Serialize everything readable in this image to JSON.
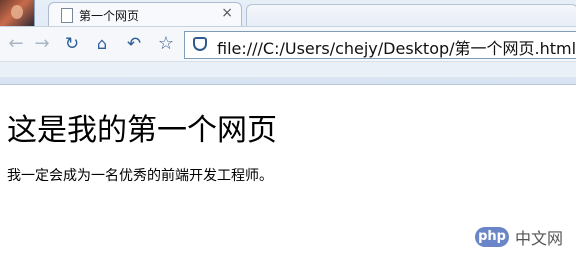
{
  "browser": {
    "tab_title": "第一个网页",
    "tab_close_symbol": "×",
    "address_url": "file:///C:/Users/chejy/Desktop/第一个网页.html",
    "icons": [
      "back-icon",
      "forward-icon",
      "reload-icon",
      "home-icon",
      "undo-icon",
      "star-icon",
      "site-security-icon",
      "page-icon",
      "close-icon"
    ]
  },
  "page": {
    "heading": "这是我的第一个网页",
    "paragraph": "我一定会成为一名优秀的前端开发工程师。"
  },
  "watermark": {
    "logo": "php",
    "text": "中文网"
  },
  "colors": {
    "chrome_blue": "#2c5d96",
    "watermark_blue": "#6b86c8"
  }
}
